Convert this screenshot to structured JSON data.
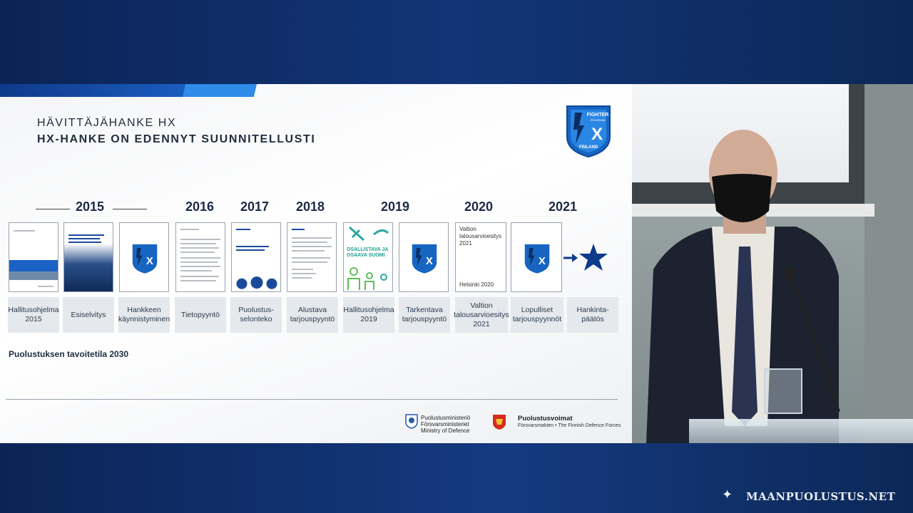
{
  "slide": {
    "kicker": "HÄVITTÄJÄHANKE HX",
    "headline": "HX-HANKE ON EDENNYT SUUNNITELLUSTI",
    "badge_text": {
      "top": "FIGHTER",
      "mid": "PROGRAM",
      "x": "X",
      "bottom": "FINLAND"
    },
    "years": [
      "2015",
      "2016",
      "2017",
      "2018",
      "2019",
      "2020",
      "2021"
    ],
    "documents": [
      {
        "label": "Hallitusohjelma\n2015",
        "type": "report-blue"
      },
      {
        "label": "Esiselvitys",
        "type": "cover-dark"
      },
      {
        "label": "Hankkeen\nkäynnistyminen",
        "type": "badge"
      },
      {
        "label": "Tietopyyntö",
        "type": "text-page"
      },
      {
        "label": "Puolustus-\nselonteko",
        "type": "report-people"
      },
      {
        "label": "Alustava\ntarjouspyyntö",
        "type": "text-page"
      },
      {
        "label": "Hallitusohjelma\n2019",
        "type": "osallistava"
      },
      {
        "label": "Tarkentava\ntarjouspyyntö",
        "type": "badge"
      },
      {
        "label": "Valtion\ntalousarvioesitys\n2021",
        "type": "budget"
      },
      {
        "label": "Lopulliset\ntarjouspyynnöt",
        "type": "badge"
      },
      {
        "label": "Hankinta-\npäätös",
        "type": "star"
      }
    ],
    "doc_texts": {
      "osallistava_line1": "OSALLISTAVA JA",
      "osallistava_line2": "OSAAVA SUOMI",
      "budget_title": "Valtion\ntalousarvioesitys\n2021",
      "budget_city": "Helsinki 2020"
    },
    "target_text": "Puolustuksen tavoitetila 2030",
    "ministry_lines": [
      "Puolustusministeriö",
      "Försvarsministeriet",
      "Ministry of Defence"
    ],
    "forces_name": "Puolustusvoimat",
    "forces_sub": "Försvarsmakten • The Finnish Defence Forces"
  },
  "watermark": "MAANPUOLUSTUS.NET",
  "colors": {
    "navy": "#0d2a5c",
    "accent": "#1a5bbd",
    "badge_blue": "#1765c1",
    "star": "#0d3a8a"
  }
}
